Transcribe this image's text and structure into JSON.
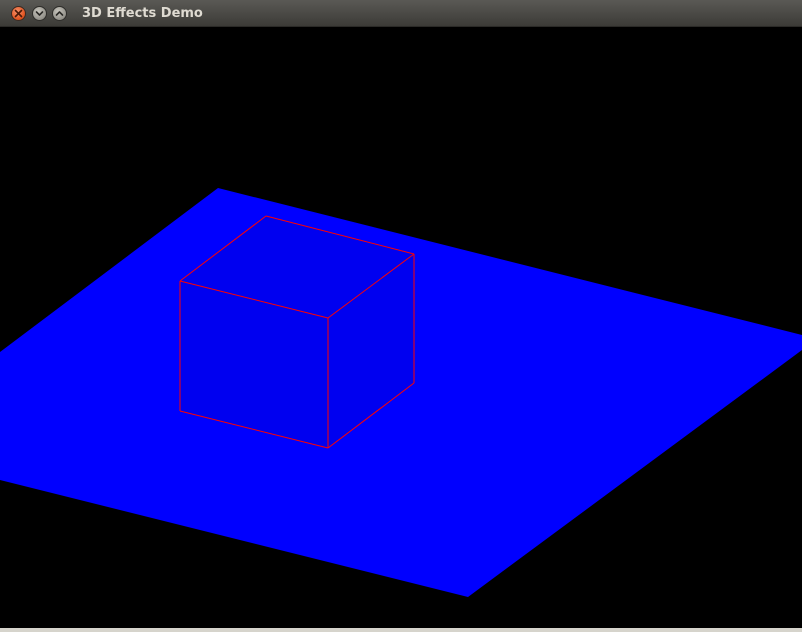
{
  "window": {
    "title": "3D Effects Demo",
    "controls": [
      "close-icon",
      "minimize-icon",
      "maximize-icon"
    ]
  },
  "scene": {
    "background_color": "#000000",
    "floor_color": "#0000ff",
    "cube_fill_color": "#0000f0",
    "cube_edge_color": "#ff0000"
  }
}
